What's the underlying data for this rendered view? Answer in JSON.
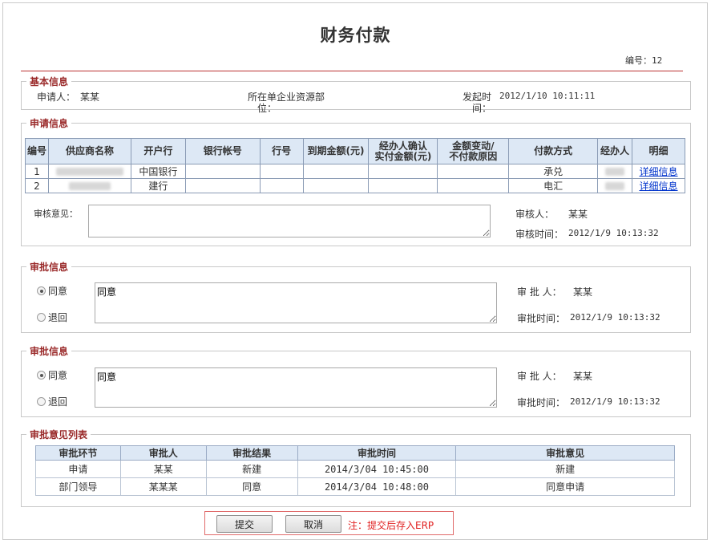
{
  "page": {
    "title": "财务付款",
    "serial_label": "编号：",
    "serial_value": "12"
  },
  "basic": {
    "legend": "基本信息",
    "applicant_label": "申请人：",
    "applicant_value": "某某",
    "unit_label_1": "所在单",
    "unit_label_2": "位：",
    "unit_value": "企业资源部",
    "time_label_1": "发起时",
    "time_label_2": "间：",
    "time_value": "2012/1/10 10:11:11"
  },
  "apply": {
    "legend": "申请信息",
    "headers": [
      "编号",
      "供应商名称",
      "开户行",
      "银行帐号",
      "行号",
      "到期金额(元)",
      "经办人确认\n实付金额(元)",
      "金额变动/\n不付款原因",
      "付款方式",
      "经办人",
      "明细"
    ],
    "rows": [
      {
        "no": "1",
        "bank": "中国银行",
        "pay_method": "承兑",
        "detail": "详细信息"
      },
      {
        "no": "2",
        "bank": "建行",
        "pay_method": "电汇",
        "detail": "详细信息"
      }
    ],
    "review_label": "审核意见：",
    "review_text": "",
    "reviewer_label": "审核人：",
    "reviewer_value": "某某",
    "review_time_label": "审核时间：",
    "review_time_value": "2012/1/9 10:13:32"
  },
  "approval1": {
    "legend": "审批信息",
    "agree": "同意",
    "reject": "退回",
    "selected": "agree",
    "opinion": "同意",
    "approver_label": "审 批 人：",
    "approver_value": "某某",
    "time_label": "审批时间：",
    "time_value": "2012/1/9 10:13:32"
  },
  "approval2": {
    "legend": "审批信息",
    "agree": "同意",
    "reject": "退回",
    "selected": "agree",
    "opinion": "同意",
    "approver_label": "审 批 人：",
    "approver_value": "某某",
    "time_label": "审批时间：",
    "time_value": "2012/1/9 10:13:32"
  },
  "opinion_list": {
    "legend": "审批意见列表",
    "headers": [
      "审批环节",
      "审批人",
      "审批结果",
      "审批时间",
      "审批意见"
    ],
    "rows": [
      [
        "申请",
        "某某",
        "新建",
        "2014/3/04 10:45:00",
        "新建"
      ],
      [
        "部门领导",
        "某某某",
        "同意",
        "2014/3/04 10:48:00",
        "同意申请"
      ]
    ]
  },
  "actions": {
    "submit": "提交",
    "cancel": "取消",
    "note": "注：提交后存入ERP"
  }
}
